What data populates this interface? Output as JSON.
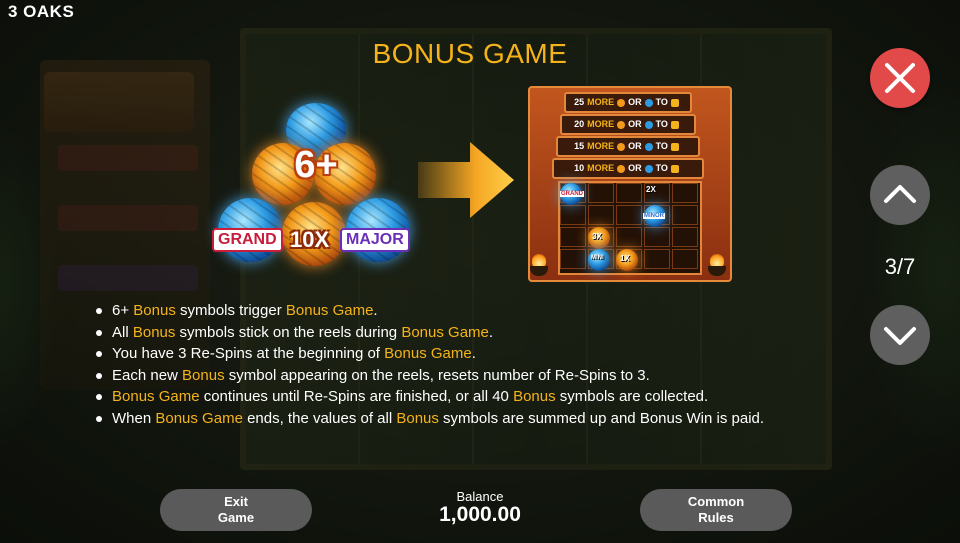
{
  "brand": "3 OAKS",
  "title": "BONUS GAME",
  "colors": {
    "accent": "#f5b31b",
    "close": "#e24a4a",
    "button": "#5a5a5a"
  },
  "illustration_left": {
    "trigger_label": "6+",
    "tags": {
      "grand": "GRAND",
      "multiplier": "10X",
      "major": "MAJOR"
    }
  },
  "illustration_right": {
    "levels": [
      {
        "prefix": "25",
        "more": "MORE",
        "or": "OR",
        "to": "TO"
      },
      {
        "prefix": "20",
        "more": "MORE",
        "or": "OR",
        "to": "TO"
      },
      {
        "prefix": "15",
        "more": "MORE",
        "or": "OR",
        "to": "TO"
      },
      {
        "prefix": "10",
        "more": "MORE",
        "or": "OR",
        "to": "TO"
      }
    ],
    "grid_labels": {
      "grand": "GRAND",
      "minor": "MINOR",
      "mini": "MINI",
      "x2": "2X",
      "x3": "3X",
      "x1": "1X"
    }
  },
  "rules": [
    [
      {
        "t": "6+ "
      },
      {
        "t": "Bonus",
        "h": true
      },
      {
        "t": " symbols trigger "
      },
      {
        "t": "Bonus Game",
        "h": true
      },
      {
        "t": "."
      }
    ],
    [
      {
        "t": "All "
      },
      {
        "t": "Bonus",
        "h": true
      },
      {
        "t": " symbols stick on the reels during "
      },
      {
        "t": "Bonus Game",
        "h": true
      },
      {
        "t": "."
      }
    ],
    [
      {
        "t": "You have 3 Re-Spins at the beginning of "
      },
      {
        "t": "Bonus Game",
        "h": true
      },
      {
        "t": "."
      }
    ],
    [
      {
        "t": "Each new "
      },
      {
        "t": "Bonus",
        "h": true
      },
      {
        "t": " symbol appearing on the reels, resets number of Re-Spins to 3."
      }
    ],
    [
      {
        "t": "Bonus Game",
        "h": true
      },
      {
        "t": " continues until Re-Spins are finished, or all 40 "
      },
      {
        "t": "Bonus",
        "h": true
      },
      {
        "t": " symbols are collected."
      }
    ],
    [
      {
        "t": "When "
      },
      {
        "t": "Bonus Game",
        "h": true
      },
      {
        "t": " ends, the values of all "
      },
      {
        "t": "Bonus",
        "h": true
      },
      {
        "t": " symbols are summed up and Bonus Win is paid."
      }
    ]
  ],
  "pagination": {
    "current": 3,
    "total": 7,
    "text": "3/7"
  },
  "icons": {
    "close": "close-icon",
    "up": "chevron-up-icon",
    "down": "chevron-down-icon",
    "arrow": "arrow-right-icon"
  },
  "bottom": {
    "exit": {
      "line1": "Exit",
      "line2": "Game"
    },
    "balance_label": "Balance",
    "balance_value": "1,000.00",
    "common": {
      "line1": "Common",
      "line2": "Rules"
    }
  }
}
